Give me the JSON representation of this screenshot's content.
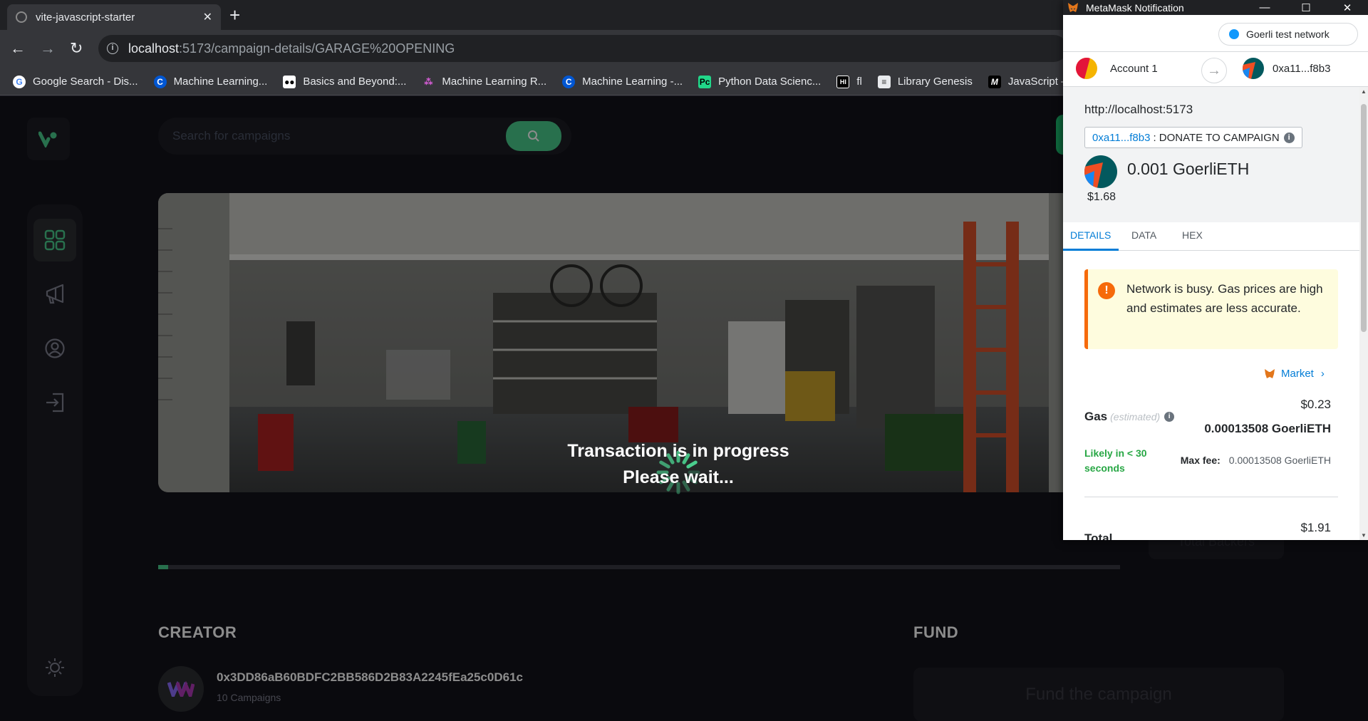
{
  "browser": {
    "tab_title": "vite-javascript-starter",
    "url_host": "localhost",
    "url_path": ":5173/campaign-details/GARAGE%20OPENING",
    "bookmarks": [
      {
        "label": "Google Search - Dis...",
        "icon": "google-icon"
      },
      {
        "label": "Machine Learning...",
        "icon": "coursera-icon"
      },
      {
        "label": "Basics and Beyond:...",
        "icon": "medium-icon"
      },
      {
        "label": "Machine Learning R...",
        "icon": "pattern-icon"
      },
      {
        "label": "Machine Learning -...",
        "icon": "coursera-icon"
      },
      {
        "label": "Python Data Scienc...",
        "icon": "pycharm-icon"
      },
      {
        "label": "fl",
        "icon": "hashnode-icon"
      },
      {
        "label": "Library Genesis",
        "icon": "book-icon"
      },
      {
        "label": "JavaScript — D",
        "icon": "mdn-icon"
      }
    ]
  },
  "app": {
    "search_placeholder": "Search for campaigns",
    "loader_line1": "Transaction is in progress",
    "loader_line2": "Please wait...",
    "progress_fraction": 0.01,
    "creator_title": "CREATOR",
    "creator_address": "0x3DD86aB60BDFC2BB586D2B83A2245fEa25c0D61c",
    "creator_campaigns": "10 Campaigns",
    "fund_title": "FUND",
    "fund_button": "Fund the campaign",
    "backers_label": "Total Backers",
    "accent": "#4acd8d"
  },
  "metamask": {
    "window_title": "MetaMask Notification",
    "network": "Goerli test network",
    "from_account": "Account 1",
    "to_account": "0xa11...f8b3",
    "origin": "http://localhost:5173",
    "method_address": "0xa11...f8b3",
    "method_name": ": DONATE TO CAMPAIGN",
    "amount": "0.001 GoerliETH",
    "amount_fiat": "$1.68",
    "tabs": [
      "DETAILS",
      "DATA",
      "HEX"
    ],
    "warning": "Network is busy. Gas prices are high and estimates are less accurate.",
    "market_label": "Market",
    "gas_label": "Gas",
    "gas_estimated": "(estimated)",
    "gas_fiat": "$0.23",
    "gas_eth": "0.00013508 GoerliETH",
    "likely": "Likely in < 30 seconds",
    "max_fee_label": "Max fee:",
    "max_fee_value": "0.00013508 GoerliETH",
    "total_label": "Total",
    "total_fiat": "$1.91"
  }
}
